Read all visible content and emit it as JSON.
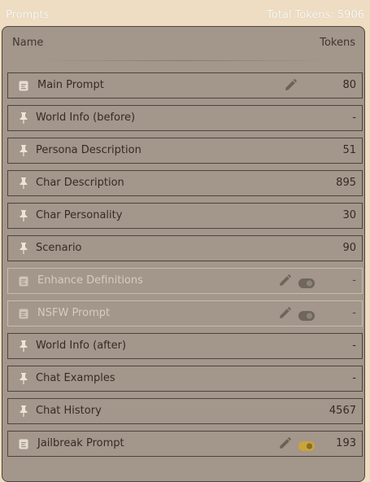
{
  "header": {
    "title": "Prompts",
    "total_tokens": "Total Tokens: 5906"
  },
  "columns": {
    "name": "Name",
    "tokens": "Tokens"
  },
  "prompts": [
    {
      "label": "Main Prompt",
      "tokens": "80",
      "icon": "document-icon",
      "editable": true,
      "toggle": null,
      "disabled": false
    },
    {
      "label": "World Info (before)",
      "tokens": "-",
      "icon": "pin-icon",
      "editable": false,
      "toggle": null,
      "disabled": false
    },
    {
      "label": "Persona Description",
      "tokens": "51",
      "icon": "pin-icon",
      "editable": false,
      "toggle": null,
      "disabled": false
    },
    {
      "label": "Char Description",
      "tokens": "895",
      "icon": "pin-icon",
      "editable": false,
      "toggle": null,
      "disabled": false
    },
    {
      "label": "Char Personality",
      "tokens": "30",
      "icon": "pin-icon",
      "editable": false,
      "toggle": null,
      "disabled": false
    },
    {
      "label": "Scenario",
      "tokens": "90",
      "icon": "pin-icon",
      "editable": false,
      "toggle": null,
      "disabled": false
    },
    {
      "label": "Enhance Definitions",
      "tokens": "-",
      "icon": "document-icon",
      "editable": true,
      "toggle": "off",
      "disabled": true
    },
    {
      "label": "NSFW Prompt",
      "tokens": "-",
      "icon": "document-icon",
      "editable": true,
      "toggle": "off",
      "disabled": true
    },
    {
      "label": "World Info (after)",
      "tokens": "-",
      "icon": "pin-icon",
      "editable": false,
      "toggle": null,
      "disabled": false
    },
    {
      "label": "Chat Examples",
      "tokens": "-",
      "icon": "pin-icon",
      "editable": false,
      "toggle": null,
      "disabled": false
    },
    {
      "label": "Chat History",
      "tokens": "4567",
      "icon": "pin-icon",
      "editable": false,
      "toggle": null,
      "disabled": false
    },
    {
      "label": "Jailbreak Prompt",
      "tokens": "193",
      "icon": "document-icon",
      "editable": true,
      "toggle": "on",
      "disabled": false
    }
  ],
  "colors": {
    "page_bg": "#eeddc2",
    "panel_bg": "#a3968a",
    "border": "#4d453d",
    "toggle_on": "#c9a43c"
  }
}
